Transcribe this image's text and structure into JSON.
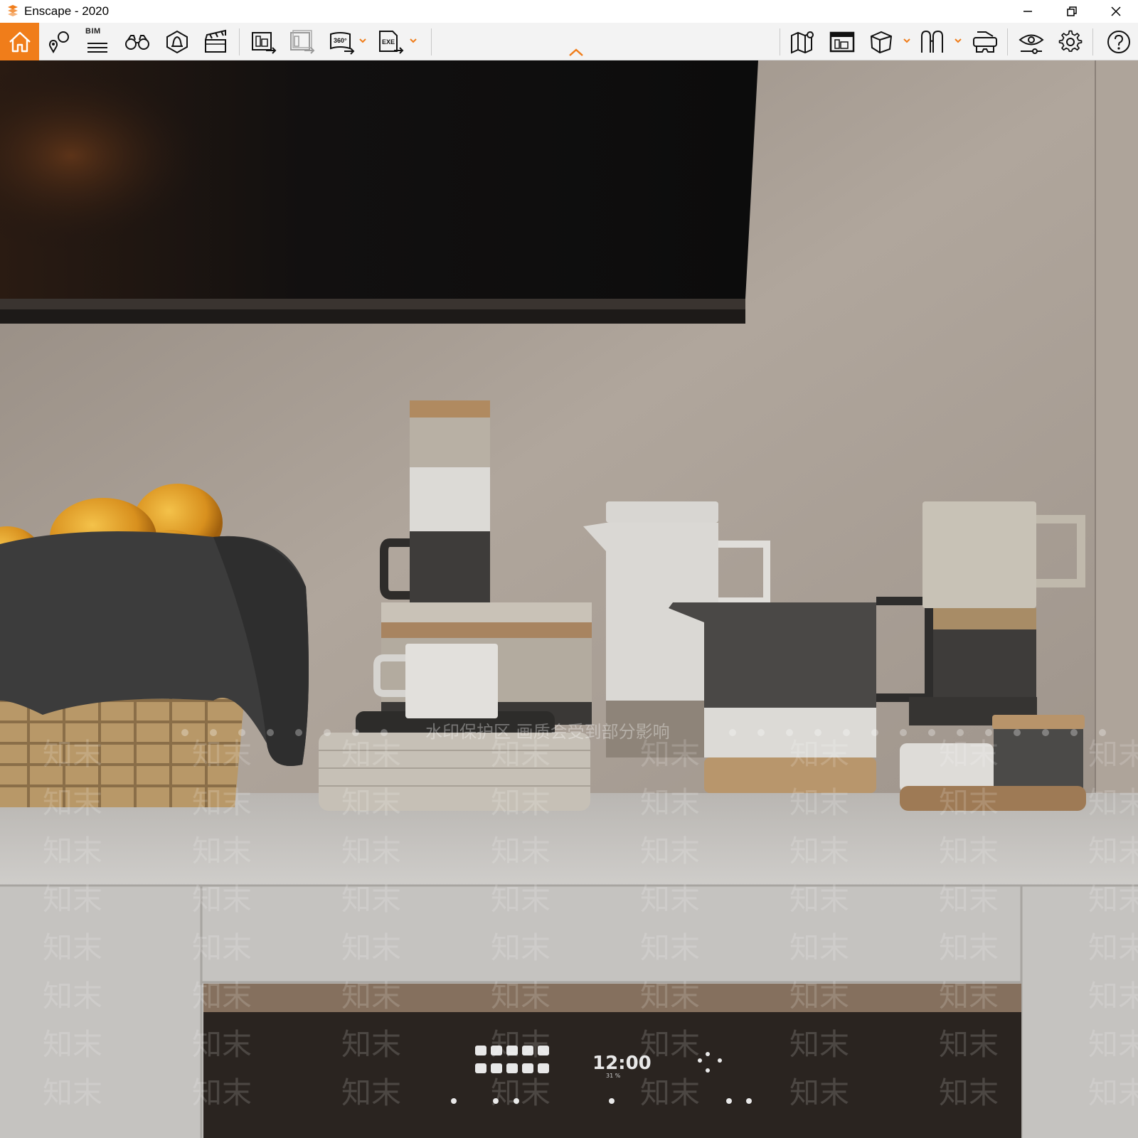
{
  "window": {
    "title": "Enscape - 2020"
  },
  "toolbar": {
    "bim_label": "BIM",
    "icons": [
      "home-icon",
      "location-pin-icon",
      "bim-info-icon",
      "binoculars-icon",
      "sky-bell-icon",
      "clapper-icon",
      "screenshot-export-icon",
      "batch-export-icon",
      "panorama-360-icon",
      "exe-export-icon",
      "map-icon",
      "collaboration-icon",
      "cube-view-icon",
      "sections-icon",
      "vr-headset-icon",
      "visual-settings-icon",
      "gear-icon",
      "help-icon"
    ]
  },
  "viewport": {
    "watermark_banner": "水印保护区  画质会受到部分影响",
    "watermark_tile": "知末",
    "oven_clock": "12:00",
    "oven_sub": "31 %"
  },
  "colors": {
    "accent": "#f07d1a",
    "toolbar_bg": "#f3f3f3",
    "wall": "#a59a90",
    "counter": "#c8c6c3"
  }
}
